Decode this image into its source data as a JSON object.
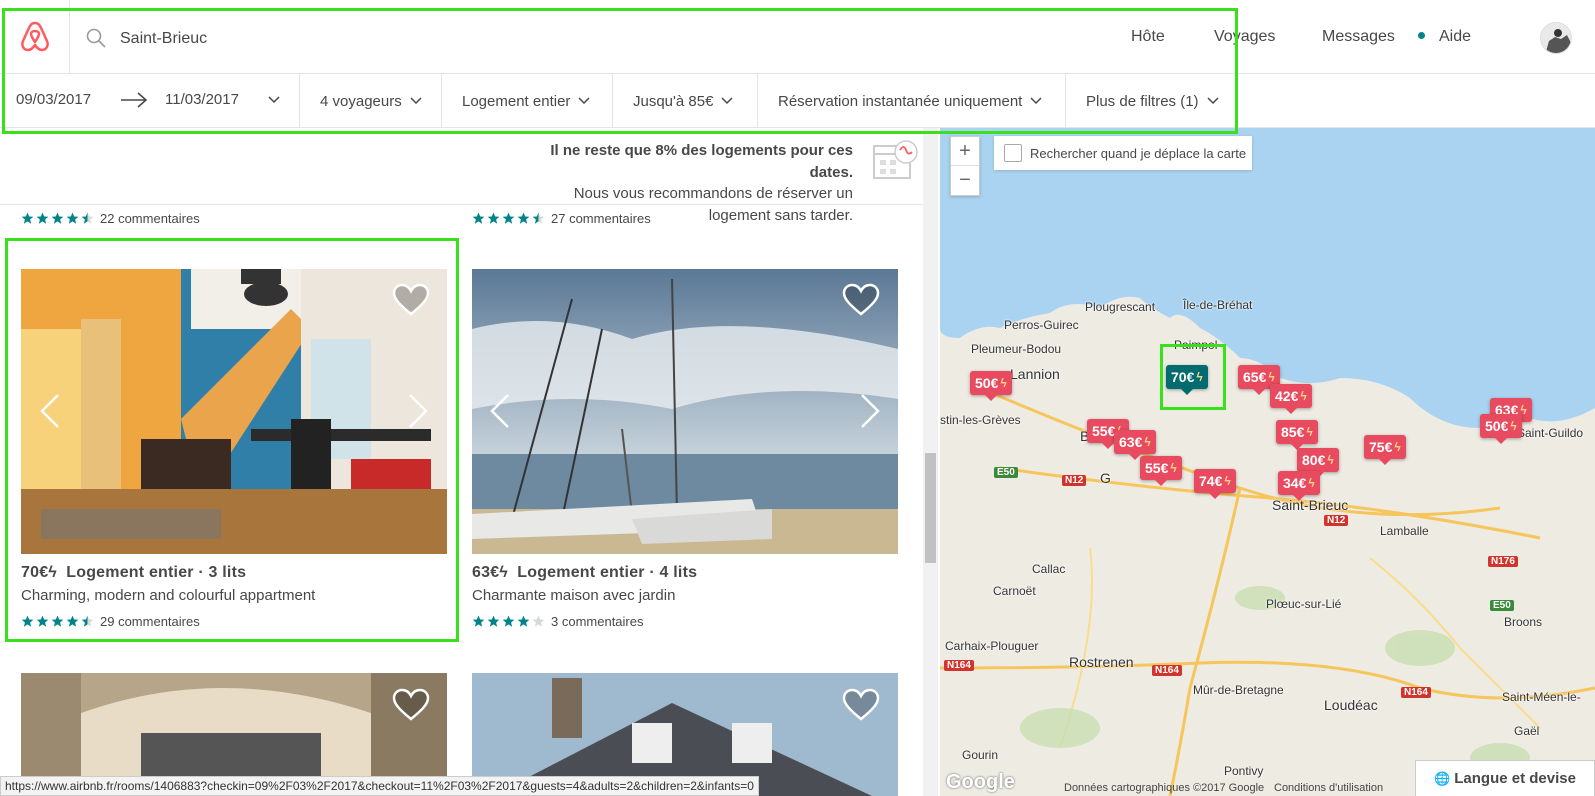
{
  "header": {
    "search": {
      "value": "Saint-Brieuc"
    },
    "nav": [
      "Hôte",
      "Voyages",
      "Messages",
      "Aide"
    ]
  },
  "filters": {
    "checkin": "09/03/2017",
    "checkout": "11/03/2017",
    "guests": "4 voyageurs",
    "room_type": "Logement entier",
    "price": "Jusqu'à 85€",
    "instant": "Réservation instantanée uniquement",
    "more": "Plus de filtres (1)"
  },
  "scarcity": {
    "bold": "Il ne reste que 8% des logements pour ces dates.",
    "text": "Nous vous recommandons de réserver un logement sans tarder."
  },
  "top_ratings": [
    {
      "stars": 4.5,
      "label": "22 commentaires"
    },
    {
      "stars": 4.5,
      "label": "27 commentaires"
    }
  ],
  "listings": [
    {
      "price": "70€",
      "title": "Logement entier · 3 lits",
      "subtitle": "Charming, modern and colourful appartment",
      "stars": 4.5,
      "reviews": "29 commentaires"
    },
    {
      "price": "63€",
      "title": "Logement entier · 4 lits",
      "subtitle": "Charmante maison avec jardin",
      "stars": 4,
      "reviews": "3 commentaires"
    }
  ],
  "map": {
    "search_checkbox": "Rechercher quand je déplace la carte",
    "markers": [
      "50€",
      "70€",
      "65€",
      "42€",
      "55€",
      "63€",
      "85€",
      "55€",
      "74€",
      "80€",
      "34€",
      "75€",
      "50€",
      "63€"
    ],
    "places": [
      "Plougrescant",
      "Île-de-Bréhat",
      "Perros-Guirec",
      "Pleumeur-Bodou",
      "Paimpol",
      "Lannion",
      "stin-les-Grèves",
      "Saint-Brieuc",
      "Lamballe",
      "Callac",
      "Carnoët",
      "Plœuc-sur-Lié",
      "Broons",
      "Carhaix-Plouguer",
      "Rostrenen",
      "Mûr-de-Bretagne",
      "Loudéac",
      "Saint-Méen-le-",
      "Gourin",
      "Pontivy",
      "Gaël",
      "Saint-Guildo",
      "B",
      "G"
    ],
    "roads": [
      "E50",
      "N12",
      "N12",
      "N176",
      "E50",
      "N164",
      "N164",
      "N164"
    ],
    "attribution": [
      "Données cartographiques ©2017 Google",
      "Conditions d'utilisation"
    ],
    "google": "Google",
    "lang_button": "Langue et devise"
  },
  "status_url": "https://www.airbnb.fr/rooms/1406883?checkin=09%2F03%2F2017&checkout=11%2F03%2F2017&guests=4&adults=2&children=2&infants=0",
  "colors": {
    "brand": "#ff5a5f",
    "teal": "#008489",
    "marker": "#e84a5f",
    "highlight": "#39e01c"
  }
}
